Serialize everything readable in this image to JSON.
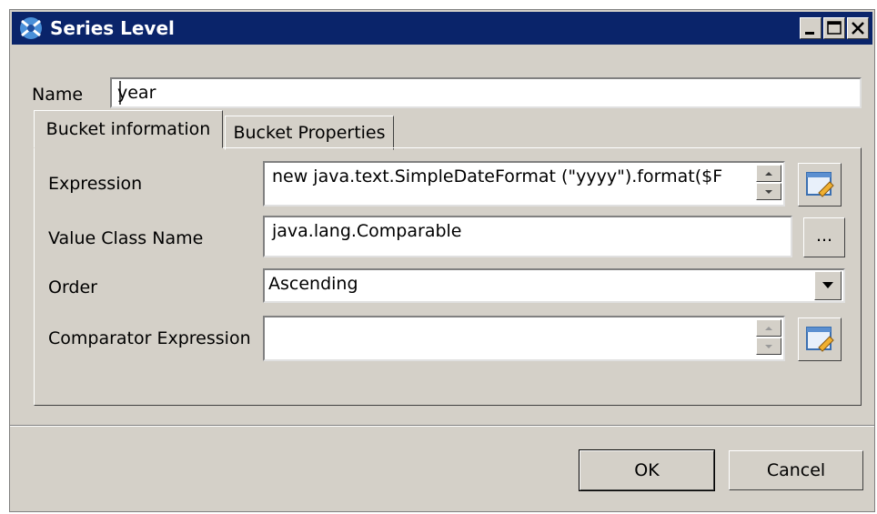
{
  "window": {
    "title": "Series Level"
  },
  "name_field": {
    "label": "Name",
    "value": "year"
  },
  "tabs": [
    {
      "label": "Bucket information",
      "active": true
    },
    {
      "label": "Bucket Properties",
      "active": false
    }
  ],
  "fields": {
    "expression": {
      "label": "Expression",
      "value": "new java.text.SimpleDateFormat (\"yyyy\").format($F"
    },
    "value_class": {
      "label": "Value Class Name",
      "value": "java.lang.Comparable",
      "browse_label": "..."
    },
    "order": {
      "label": "Order",
      "value": "Ascending"
    },
    "comparator": {
      "label": "Comparator Expression",
      "value": ""
    }
  },
  "buttons": {
    "ok": "OK",
    "cancel": "Cancel"
  },
  "icons": {
    "app": "jasper-app-icon",
    "minimize": "minimize-icon",
    "maximize": "maximize-icon",
    "close": "close-icon",
    "edit": "expression-editor-icon"
  },
  "colors": {
    "titlebar": "#0a246a",
    "face": "#d4d0c8"
  }
}
